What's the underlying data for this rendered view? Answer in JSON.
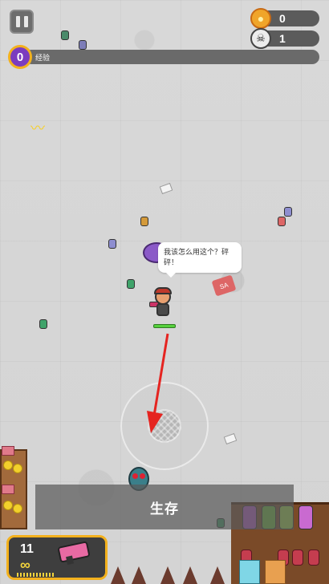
{
  "hud": {
    "coins": "0",
    "kills": "1",
    "level_number": "0",
    "level_label": "经验",
    "coin_icon": "coin-icon",
    "skull_icon": "skull-icon",
    "pause_icon": "pause-icon"
  },
  "dialog": {
    "speech_text": "我该怎么用这个？砰砰！"
  },
  "objective": {
    "text": "生存"
  },
  "weapon": {
    "ammo_count": "11",
    "ammo_reserve": "∞",
    "weapon_icon": "blaster-gun-icon"
  },
  "props": {
    "sale_sign_text": "SA"
  },
  "colors": {
    "accent_gold": "#f3b11d",
    "level_purple": "#7b3cbf",
    "arrow_red": "#e52420",
    "health_green": "#56d13d"
  }
}
